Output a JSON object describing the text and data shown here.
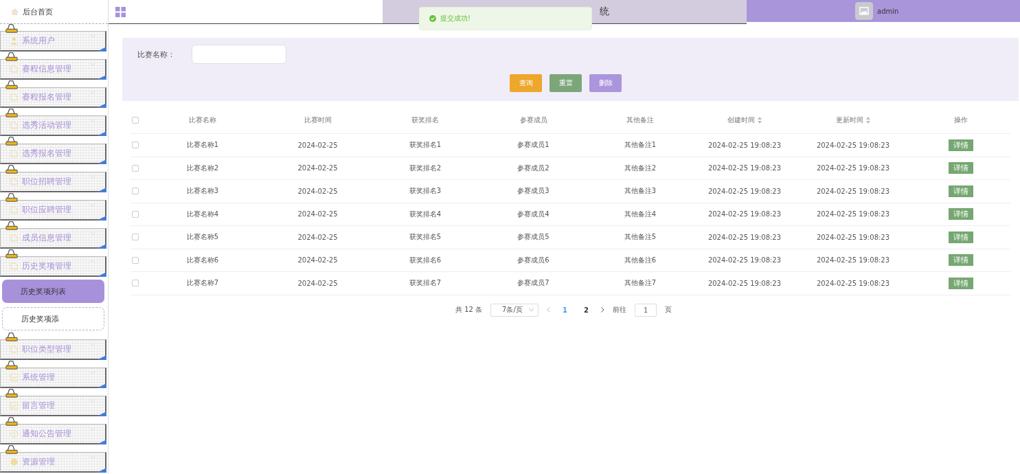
{
  "header": {
    "title": "统",
    "user": "admin"
  },
  "toast": {
    "kind": "success",
    "text": "提交成功!"
  },
  "sidebar": {
    "home": "后台首页",
    "menu": [
      {
        "label": "系统用户",
        "kind": "person",
        "expanded": false
      },
      {
        "label": "赛程信息管理",
        "kind": "doc",
        "expanded": false
      },
      {
        "label": "赛程报名管理",
        "kind": "doc",
        "expanded": false
      },
      {
        "label": "选秀活动管理",
        "kind": "doc",
        "expanded": false
      },
      {
        "label": "选秀报名管理",
        "kind": "doc",
        "expanded": false
      },
      {
        "label": "职位招聘管理",
        "kind": "doc",
        "expanded": false
      },
      {
        "label": "职位应聘管理",
        "kind": "doc",
        "expanded": false
      },
      {
        "label": "成员信息管理",
        "kind": "doc",
        "expanded": false
      },
      {
        "label": "历史奖项管理",
        "kind": "doc",
        "expanded": true,
        "children": [
          {
            "label": "历史奖项列表",
            "selected": true
          },
          {
            "label": "历史奖项添",
            "selected": false
          }
        ]
      },
      {
        "label": "职位类型管理",
        "kind": "doc",
        "expanded": false
      },
      {
        "label": "系统管理",
        "kind": "image",
        "expanded": false
      },
      {
        "label": "留言管理",
        "kind": "image",
        "expanded": false
      },
      {
        "label": "通知公告管理",
        "kind": "info",
        "expanded": false
      },
      {
        "label": "资源管理",
        "kind": "dot",
        "expanded": false
      }
    ]
  },
  "search": {
    "label": "比赛名称：",
    "buttons": [
      {
        "label": "查询",
        "kind": "query"
      },
      {
        "label": "重置",
        "kind": "reset"
      },
      {
        "label": "删除",
        "kind": "delete"
      }
    ]
  },
  "table": {
    "all_checked": false,
    "columns": [
      {
        "label": "比赛名称",
        "sortable": false
      },
      {
        "label": "比赛时间",
        "sortable": false
      },
      {
        "label": "获奖排名",
        "sortable": false
      },
      {
        "label": "参赛成员",
        "sortable": false
      },
      {
        "label": "其他备注",
        "sortable": false
      },
      {
        "label": "创建时间",
        "sortable": true
      },
      {
        "label": "更新时间",
        "sortable": true
      },
      {
        "label": "操作",
        "sortable": false
      }
    ],
    "rows": [
      {
        "checked": false,
        "cells": [
          "比赛名称1",
          "2024-02-25",
          "获奖排名1",
          "参赛成员1",
          "其他备注1",
          "2024-02-25 19:08:23",
          "2024-02-25 19:08:23"
        ],
        "action": "详情"
      },
      {
        "checked": false,
        "cells": [
          "比赛名称2",
          "2024-02-25",
          "获奖排名2",
          "参赛成员2",
          "其他备注2",
          "2024-02-25 19:08:23",
          "2024-02-25 19:08:23"
        ],
        "action": "详情"
      },
      {
        "checked": false,
        "cells": [
          "比赛名称3",
          "2024-02-25",
          "获奖排名3",
          "参赛成员3",
          "其他备注3",
          "2024-02-25 19:08:23",
          "2024-02-25 19:08:23"
        ],
        "action": "详情"
      },
      {
        "checked": false,
        "cells": [
          "比赛名称4",
          "2024-02-25",
          "获奖排名4",
          "参赛成员4",
          "其他备注4",
          "2024-02-25 19:08:23",
          "2024-02-25 19:08:23"
        ],
        "action": "详情"
      },
      {
        "checked": false,
        "cells": [
          "比赛名称5",
          "2024-02-25",
          "获奖排名5",
          "参赛成员5",
          "其他备注5",
          "2024-02-25 19:08:23",
          "2024-02-25 19:08:23"
        ],
        "action": "详情"
      },
      {
        "checked": false,
        "cells": [
          "比赛名称6",
          "2024-02-25",
          "获奖排名6",
          "参赛成员6",
          "其他备注6",
          "2024-02-25 19:08:23",
          "2024-02-25 19:08:23"
        ],
        "action": "详情"
      },
      {
        "checked": false,
        "cells": [
          "比赛名称7",
          "2024-02-25",
          "获奖排名7",
          "参赛成员7",
          "其他备注7",
          "2024-02-25 19:08:23",
          "2024-02-25 19:08:23"
        ],
        "action": "详情"
      }
    ]
  },
  "pagination": {
    "total": "共 12 条",
    "page_size": "7条/页",
    "pages": [
      {
        "label": "1",
        "selected": true
      },
      {
        "label": "2",
        "selected": false
      }
    ],
    "goto": "前往",
    "page_value": "1",
    "page_unit": "页"
  }
}
